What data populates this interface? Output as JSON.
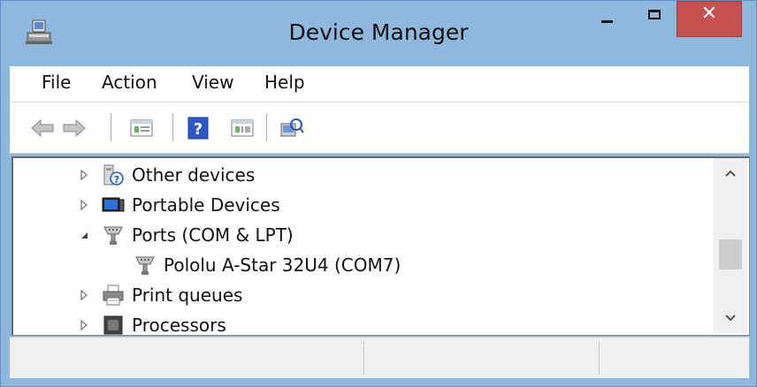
{
  "window": {
    "title": "Device Manager",
    "close_symbol": "✕"
  },
  "menu": {
    "items": [
      "File",
      "Action",
      "View",
      "Help"
    ]
  },
  "toolbar": {
    "icons": [
      "back-arrow-icon",
      "forward-arrow-icon",
      "properties-icon",
      "help-icon",
      "update-driver-icon",
      "scan-hardware-icon"
    ]
  },
  "tree": {
    "items": [
      {
        "label": "Other devices",
        "expanded": false,
        "icon": "unknown-device-icon"
      },
      {
        "label": "Portable Devices",
        "expanded": false,
        "icon": "portable-device-icon"
      },
      {
        "label": "Ports (COM & LPT)",
        "expanded": true,
        "icon": "port-connector-icon"
      },
      {
        "label": "Pololu A-Star 32U4 (COM7)",
        "child": true,
        "icon": "port-connector-icon"
      },
      {
        "label": "Print queues",
        "expanded": false,
        "icon": "printer-icon"
      },
      {
        "label": "Processors",
        "expanded": false,
        "icon": "processor-icon"
      }
    ]
  },
  "colors": {
    "titlebar": "#8fb8df",
    "close_button": "#c75050"
  }
}
